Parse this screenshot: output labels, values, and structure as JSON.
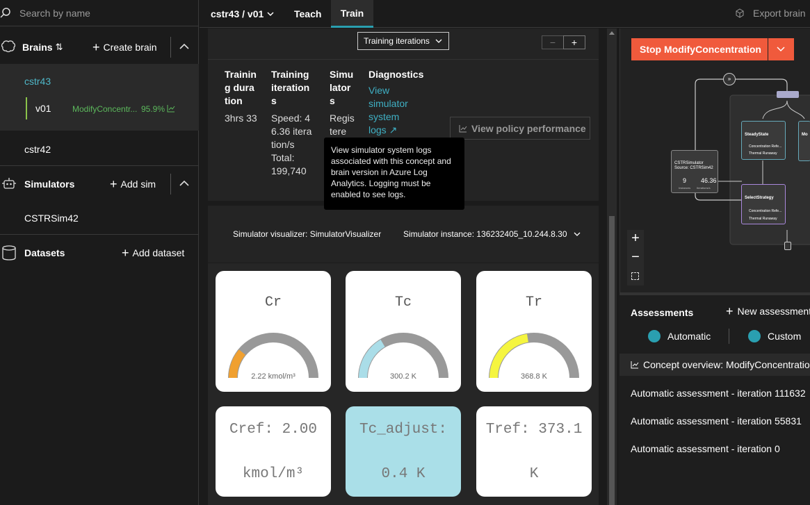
{
  "sidebar": {
    "search_placeholder": "Search by name",
    "brains": {
      "title": "Brains",
      "sort_glyph": "⇅",
      "add_label": "Create brain"
    },
    "brain_items": [
      {
        "name": "cstr43"
      },
      {
        "name": "cstr42"
      }
    ],
    "version": {
      "label": "v01",
      "concept": "ModifyConcentr...",
      "percent": "95.9%"
    },
    "simulators": {
      "title": "Simulators",
      "add_label": "Add sim",
      "items": [
        "CSTRSim42"
      ]
    },
    "datasets": {
      "title": "Datasets",
      "add_label": "Add dataset"
    }
  },
  "topbar": {
    "breadcrumb": "cstr43 / v01",
    "tabs": [
      "Teach",
      "Train"
    ],
    "active_tab": "Train",
    "export_label": "Export brain"
  },
  "chart_select": {
    "value": "Training iterations"
  },
  "zoom": {
    "minus": "−",
    "plus": "+"
  },
  "stats": {
    "col1": {
      "header": "Training duration",
      "value": "3hrs 33"
    },
    "col2": {
      "header": "Training iterations",
      "speed": "Speed: 46.36 iteration/s",
      "total": "Total: 199,740"
    },
    "col3": {
      "header": "Simulators",
      "value": "Registere"
    },
    "col4": {
      "header": "Diagnostics",
      "link": "View simulator system logs"
    }
  },
  "view_policy": "View policy performance",
  "tooltip": "View simulator system logs associated with this concept and brain version in Azure Log Analytics. Logging must be enabled to see logs.",
  "simulator": {
    "visualizer": "Simulator visualizer: SimulatorVisualizer",
    "instance": "Simulator instance: 136232405_10.244.8.30"
  },
  "gauges": [
    {
      "title": "Cr",
      "value": "2.22 kmol/m³",
      "fraction": 0.22,
      "color": "#f0a030"
    },
    {
      "title": "Tc",
      "value": "300.2 K",
      "fraction": 0.33,
      "color": "#aadde8"
    },
    {
      "title": "Tr",
      "value": "368.8 K",
      "fraction": 0.45,
      "color": "#f5f540"
    }
  ],
  "boxes": [
    {
      "line1": "Cref: 2.00",
      "line2": "kmol/m³",
      "bg": "#ffffff"
    },
    {
      "line1": "Tc_adjust:",
      "line2": "0.4 K",
      "bg": "#aadfe8"
    },
    {
      "line1": "Tref: 373.1",
      "line2": "K",
      "bg": "#ffffff"
    }
  ],
  "right": {
    "stop_label": "Stop ModifyConcentration",
    "stop_color": "#f05a3c",
    "graph": {
      "sim_node": {
        "title": "CSTRSimulator",
        "source": "Source: CSTRSim42",
        "v1": "9",
        "v2": "46.36",
        "l1": "Instances",
        "l2": "Iterations/s"
      },
      "steady": {
        "title": "SteadyState",
        "r1": "Concentration Refe...",
        "r2": "Thermal Runaway"
      },
      "select": {
        "title": "SelectStrategy",
        "r1": "Concentration Refe...",
        "r2": "Thermal Runaway"
      },
      "mod": {
        "title": "Mo"
      }
    },
    "assessments": {
      "title": "Assessments",
      "new_label": "New assessment",
      "filters": [
        "Automatic",
        "Custom"
      ],
      "concept_overview": "Concept overview: ModifyConcentratio",
      "items": [
        "Automatic assessment - iteration 111632",
        "Automatic assessment - iteration 55831",
        "Automatic assessment - iteration 0"
      ]
    }
  }
}
